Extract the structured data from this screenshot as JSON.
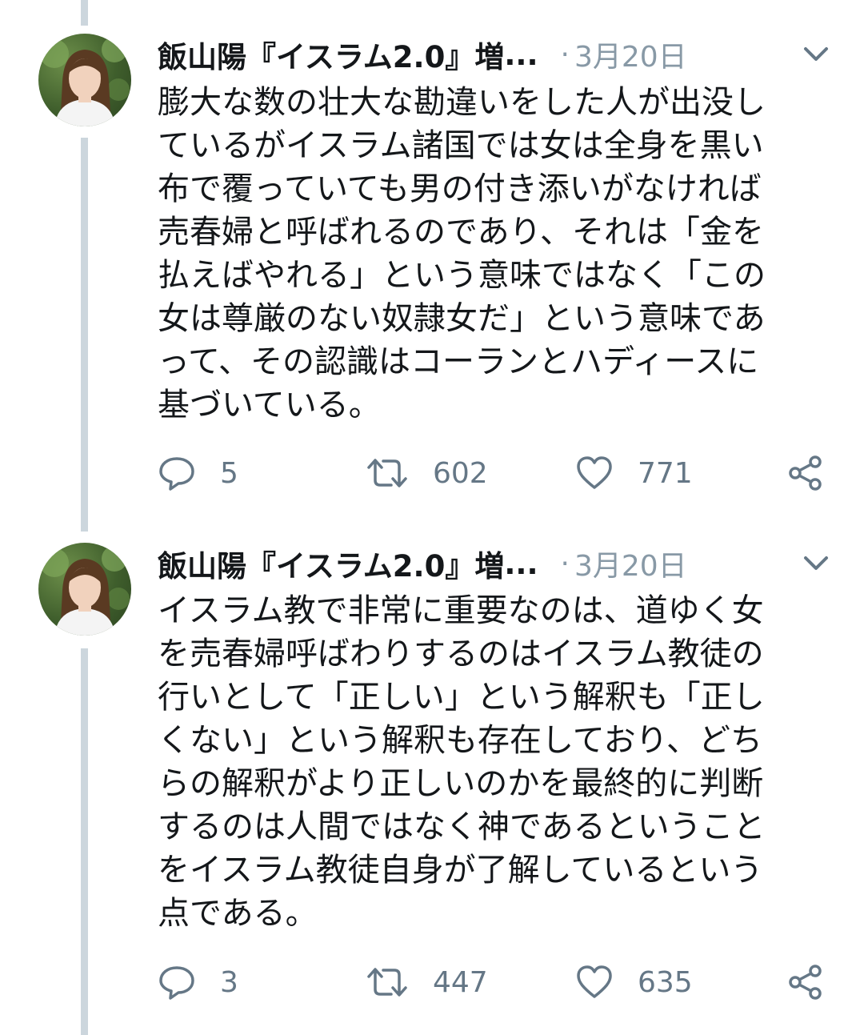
{
  "tweets": [
    {
      "author": "飯山陽『イスラム2.0』増",
      "ellipsis": "...",
      "separator": "·",
      "date": "3月20日",
      "avatar": "avatar-photo",
      "lines": [
        "膨大な数の壮大な勘違いをした人が出没し",
        "ているがイスラム諸国では女は全身を黒い",
        "布で覆っていても男の付き添いがなければ",
        "売春婦と呼ばれるのであり、それは「金を",
        "払えばやれる」という意味ではなく「この",
        "女は尊厳のない奴隷女だ」という意味であ",
        "って、その認識はコーランとハディースに",
        "基づいている。"
      ],
      "reply_count": "5",
      "retweet_count": "602",
      "like_count": "771"
    },
    {
      "author": "飯山陽『イスラム2.0』増",
      "ellipsis": "...",
      "separator": "·",
      "date": "3月20日",
      "avatar": "avatar-photo",
      "lines": [
        "イスラム教で非常に重要なのは、道ゆく女",
        "を売春婦呼ばわりするのはイスラム教徒の",
        "行いとして「正しい」という解釈も「正し",
        "くない」という解釈も存在しており、どち",
        "らの解釈がより正しいのかを最終的に判断",
        "するのは人間ではなく神であるということ",
        "をイスラム教徒自身が了解しているという",
        "点である。"
      ],
      "reply_count": "3",
      "retweet_count": "447",
      "like_count": "635"
    }
  ],
  "icons": {
    "reply": "reply-icon",
    "retweet": "retweet-icon",
    "like": "heart-icon",
    "share": "share-icon",
    "menu": "chevron-down-icon"
  },
  "colors": {
    "text": "#14171a",
    "secondary": "#8899a6",
    "action": "#657786",
    "thread_line": "#ccd6dd"
  }
}
